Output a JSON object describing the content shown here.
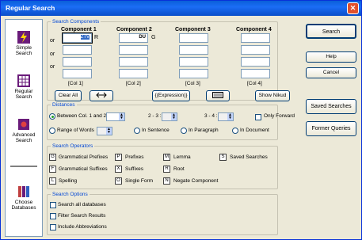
{
  "window": {
    "title": "Regular Search",
    "close": "✕"
  },
  "sidebar": {
    "items": [
      {
        "label1": "Simple",
        "label2": "Search",
        "icon": "lightning-icon"
      },
      {
        "label1": "Regular",
        "label2": "Search",
        "icon": "grid-icon"
      },
      {
        "label1": "Advanced",
        "label2": "Search",
        "icon": "book-icon"
      },
      {
        "label1": "Choose",
        "label2": "Databases",
        "icon": "books-icon"
      }
    ]
  },
  "components": {
    "title": "Search Components",
    "or": "or",
    "cols": [
      {
        "header": "Component 1",
        "first_value": "ZTV",
        "side_letter": "R",
        "col": "[Col 1]"
      },
      {
        "header": "Component 2",
        "first_value": "DU",
        "side_letter": "G",
        "col": "[Col 2]"
      },
      {
        "header": "Component 3",
        "first_value": "",
        "side_letter": "",
        "col": "[Col 3]"
      },
      {
        "header": "Component 4",
        "first_value": "",
        "side_letter": "",
        "col": "[Col 4]"
      }
    ],
    "clear_all": "Clear All",
    "expression": "{(Expression)}",
    "show_nikud": "Show Nikud"
  },
  "distances": {
    "title": "Distances",
    "between": "Between Col. 1 and 2",
    "between_value": "",
    "d23": "2 - 3 :",
    "d34": "3 - 4 :",
    "only_forward": "Only Forward",
    "range": "Range of Words",
    "in_sentence": "In Sentence",
    "in_paragraph": "In Paragraph",
    "in_document": "In Document"
  },
  "operators": {
    "title": "Search Operators",
    "items": [
      {
        "key": "G",
        "label": "Grammatical Prefixes"
      },
      {
        "key": "P",
        "label": "Prefixes"
      },
      {
        "key": "M",
        "label": "Lemma"
      },
      {
        "key": "S",
        "label": "Saved Searches"
      },
      {
        "key": "F",
        "label": "Grammatical Suffixes"
      },
      {
        "key": "X",
        "label": "Suffixes"
      },
      {
        "key": "R",
        "label": "Root"
      },
      {
        "key": "L",
        "label": "Spelling"
      },
      {
        "key": "O",
        "label": "Single Form"
      },
      {
        "key": "N",
        "label": "Negate Component"
      }
    ]
  },
  "options": {
    "title": "Search Options",
    "all_db": "Search all databases",
    "filter": "Filter Search Results",
    "abbrev": "Include Abbreviations"
  },
  "buttons": {
    "search": "Search",
    "help": "Help",
    "cancel": "Cancel",
    "saved": "Saved Searches",
    "former": "Former Queries"
  }
}
